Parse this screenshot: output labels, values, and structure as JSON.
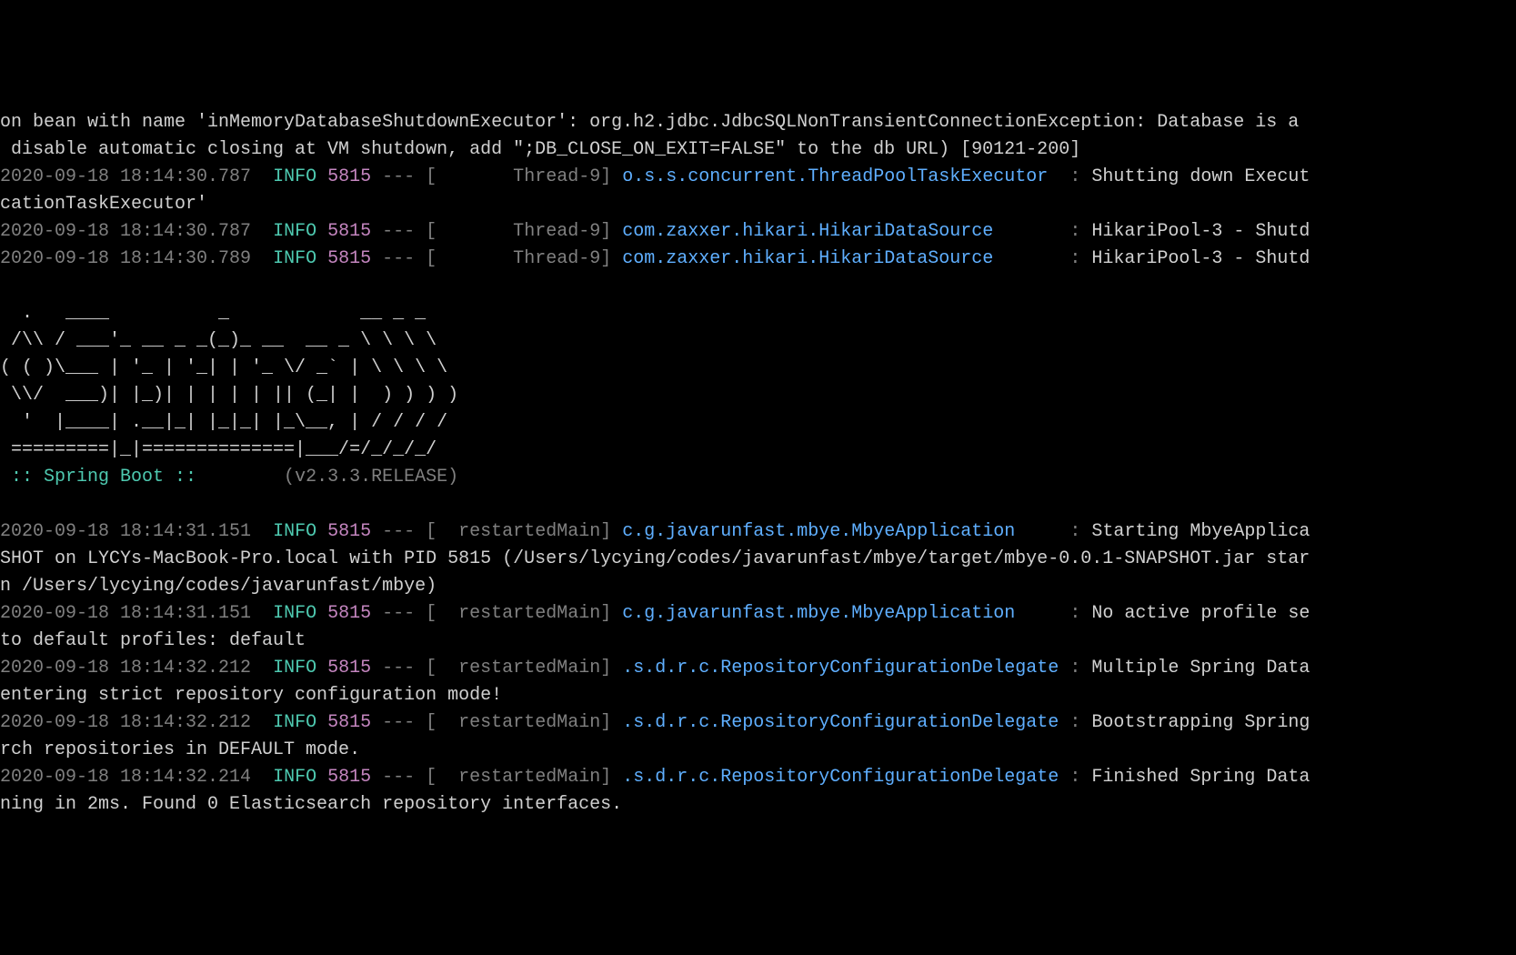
{
  "lines": {
    "top1": "on bean with name 'inMemoryDatabaseShutdownExecutor': org.h2.jdbc.JdbcSQLNonTransientConnectionException: Database is a",
    "top2": " disable automatic closing at VM shutdown, add \";DB_CLOSE_ON_EXIT=FALSE\" to the db URL) [90121-200]",
    "log1": {
      "timestamp": "2020-09-18 18:14:30.787",
      "level": "INFO",
      "pid": "5815",
      "dashes": "---",
      "thread": "       Thread-9",
      "logger": "o.s.s.concurrent.ThreadPoolTaskExecutor ",
      "message": "Shutting down Execut"
    },
    "log1b": "cationTaskExecutor'",
    "log2": {
      "timestamp": "2020-09-18 18:14:30.787",
      "level": "INFO",
      "pid": "5815",
      "dashes": "---",
      "thread": "       Thread-9",
      "logger": "com.zaxxer.hikari.HikariDataSource      ",
      "message": "HikariPool-3 - Shutd"
    },
    "log3": {
      "timestamp": "2020-09-18 18:14:30.789",
      "level": "INFO",
      "pid": "5815",
      "dashes": "---",
      "thread": "       Thread-9",
      "logger": "com.zaxxer.hikari.HikariDataSource      ",
      "message": "HikariPool-3 - Shutd"
    },
    "ascii1": "  .   ____          _            __ _ _",
    "ascii2": " /\\\\ / ___'_ __ _ _(_)_ __  __ _ \\ \\ \\ \\",
    "ascii3": "( ( )\\___ | '_ | '_| | '_ \\/ _` | \\ \\ \\ \\",
    "ascii4": " \\\\/  ___)| |_)| | | | | || (_| |  ) ) ) )",
    "ascii5": "  '  |____| .__|_| |_|_| |_\\__, | / / / /",
    "ascii6": " =========|_|==============|___/=/_/_/_/",
    "springBootLabel": " :: Spring Boot :: ",
    "springBootVersion": "       (v2.3.3.RELEASE)",
    "log4": {
      "timestamp": "2020-09-18 18:14:31.151",
      "level": "INFO",
      "pid": "5815",
      "dashes": "---",
      "thread": "  restartedMain",
      "logger": "c.g.javarunfast.mbye.MbyeApplication    ",
      "message": "Starting MbyeApplica"
    },
    "log4b": "SHOT on LYCYs-MacBook-Pro.local with PID 5815 (/Users/lycying/codes/javarunfast/mbye/target/mbye-0.0.1-SNAPSHOT.jar star",
    "log4c": "n /Users/lycying/codes/javarunfast/mbye)",
    "log5": {
      "timestamp": "2020-09-18 18:14:31.151",
      "level": "INFO",
      "pid": "5815",
      "dashes": "---",
      "thread": "  restartedMain",
      "logger": "c.g.javarunfast.mbye.MbyeApplication    ",
      "message": "No active profile se"
    },
    "log5b": "to default profiles: default",
    "log6": {
      "timestamp": "2020-09-18 18:14:32.212",
      "level": "INFO",
      "pid": "5815",
      "dashes": "---",
      "thread": "  restartedMain",
      "logger": ".s.d.r.c.RepositoryConfigurationDelegate",
      "message": "Multiple Spring Data"
    },
    "log6b": "entering strict repository configuration mode!",
    "log7": {
      "timestamp": "2020-09-18 18:14:32.212",
      "level": "INFO",
      "pid": "5815",
      "dashes": "---",
      "thread": "  restartedMain",
      "logger": ".s.d.r.c.RepositoryConfigurationDelegate",
      "message": "Bootstrapping Spring"
    },
    "log7b": "rch repositories in DEFAULT mode.",
    "log8": {
      "timestamp": "2020-09-18 18:14:32.214",
      "level": "INFO",
      "pid": "5815",
      "dashes": "---",
      "thread": "  restartedMain",
      "logger": ".s.d.r.c.RepositoryConfigurationDelegate",
      "message": "Finished Spring Data"
    },
    "log8b": "ning in 2ms. Found 0 Elasticsearch repository interfaces."
  }
}
